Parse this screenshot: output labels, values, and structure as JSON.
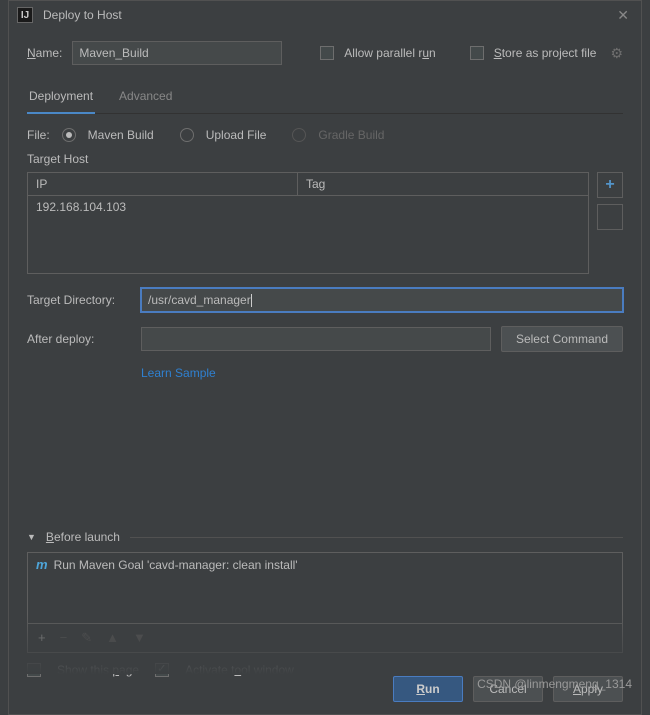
{
  "title": "Deploy to Host",
  "name_label": "Name:",
  "name_value": "Maven_Build",
  "allow_parallel": "Allow parallel run",
  "store_project": "Store as project file",
  "tabs": {
    "deployment": "Deployment",
    "advanced": "Advanced"
  },
  "file_label": "File:",
  "radios": {
    "maven": "Maven Build",
    "upload": "Upload File",
    "gradle": "Gradle Build"
  },
  "target_host": "Target Host",
  "th_ip": "IP",
  "th_tag": "Tag",
  "ip_value": "192.168.104.103",
  "target_dir_label": "Target Directory:",
  "target_dir_value": "/usr/cavd_manager",
  "after_deploy_label": "After deploy:",
  "select_cmd": "Select Command",
  "learn_sample": "Learn Sample",
  "before_launch": "Before launch",
  "maven_goal": "Run Maven Goal 'cavd-manager: clean install'",
  "show_page": "Show this page",
  "activate_tool": "Activate tool window",
  "buttons": {
    "run": "Run",
    "cancel": "Cancel",
    "apply": "Apply"
  },
  "watermark": "CSDN @linmengmeng_1314"
}
